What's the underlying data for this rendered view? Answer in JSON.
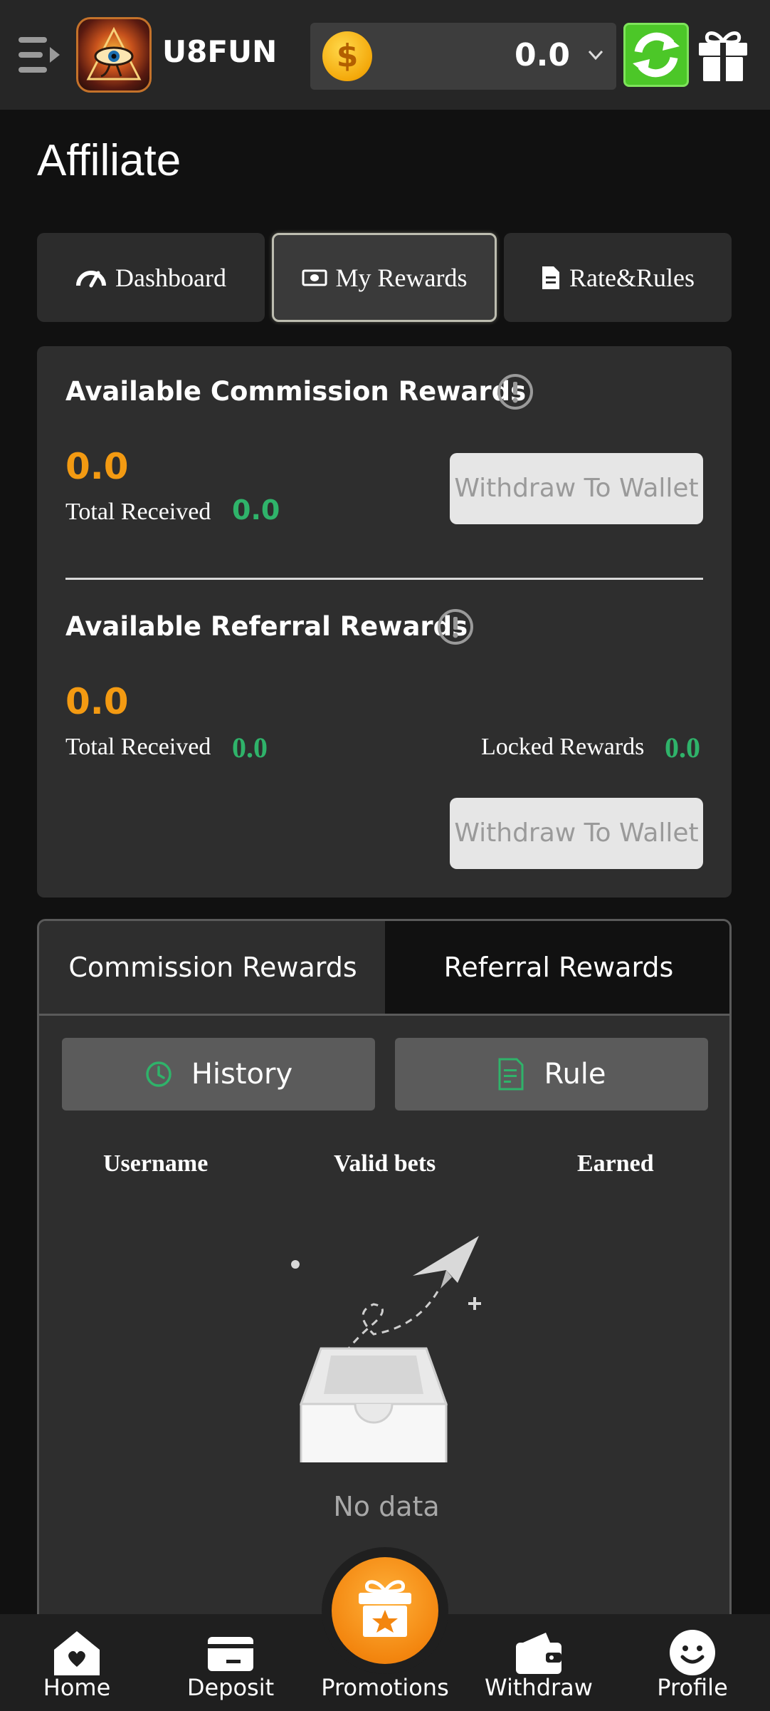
{
  "header": {
    "brand": "U8FUN",
    "balance": "0.0",
    "coin_symbol": "$",
    "icons": [
      "menu-icon",
      "logo",
      "coin-icon",
      "chevron-down-icon",
      "refresh-icon",
      "gift-icon"
    ]
  },
  "page": {
    "title": "Affiliate"
  },
  "tabs": [
    {
      "label": "Dashboard",
      "icon": "speedometer-icon",
      "active": false
    },
    {
      "label": "My Rewards",
      "icon": "money-icon",
      "active": true
    },
    {
      "label": "Rate&Rules",
      "icon": "document-icon",
      "active": false
    }
  ],
  "commission": {
    "title": "Available Commission Rewards",
    "amount": "0.0",
    "total_received_label": "Total Received",
    "total_received": "0.0",
    "withdraw_label": "Withdraw To Wallet"
  },
  "referral": {
    "title": "Available Referral Rewards",
    "amount": "0.0",
    "total_received_label": "Total Received",
    "total_received": "0.0",
    "locked_label": "Locked Rewards",
    "locked": "0.0",
    "withdraw_label": "Withdraw To Wallet"
  },
  "panel": {
    "tabs": [
      "Commission Rewards",
      "Referral Rewards"
    ],
    "history_label": "History",
    "rule_label": "Rule",
    "columns": [
      "Username",
      "Valid bets",
      "Earned"
    ],
    "empty_text": "No data"
  },
  "bottom_nav": [
    {
      "label": "Home",
      "icon": "home-icon"
    },
    {
      "label": "Deposit",
      "icon": "card-icon"
    },
    {
      "label": "Promotions",
      "icon": "gift-star-icon"
    },
    {
      "label": "Withdraw",
      "icon": "wallet-icon"
    },
    {
      "label": "Profile",
      "icon": "smile-icon"
    }
  ],
  "colors": {
    "accent_orange": "#f39a12",
    "accent_green": "#2fb36a",
    "refresh_green": "#4cc728",
    "card_bg": "#2e2e2e",
    "page_bg": "#111111"
  }
}
